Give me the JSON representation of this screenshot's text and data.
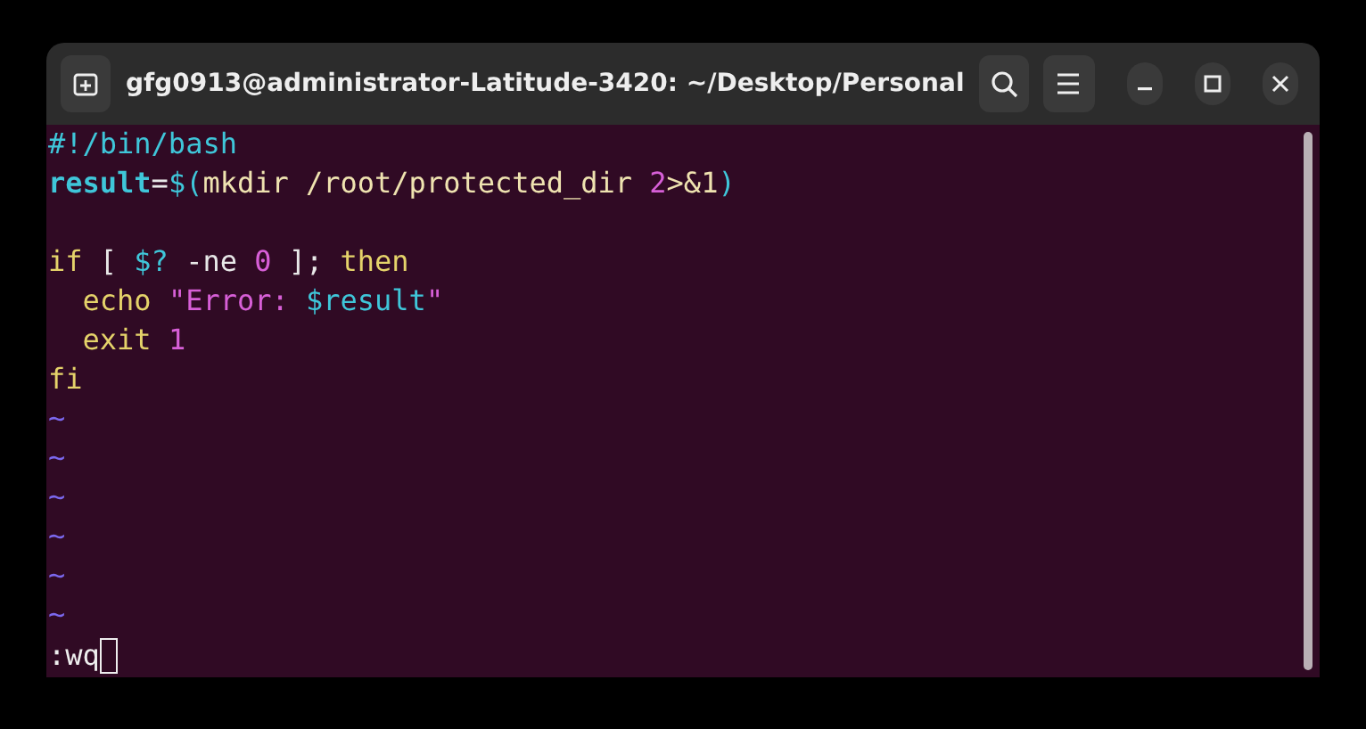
{
  "window": {
    "title": "gfg0913@administrator-Latitude-3420: ~/Desktop/Personal"
  },
  "editor": {
    "lines": [
      {
        "kind": "code",
        "segments": [
          {
            "text": "#!/bin/bash",
            "color": "#3fc6d9"
          }
        ]
      },
      {
        "kind": "code",
        "segments": [
          {
            "text": "result",
            "color": "#3fc6d9",
            "bold": true
          },
          {
            "text": "=",
            "color": "#e8e8e8"
          },
          {
            "text": "$(",
            "color": "#3fc6d9"
          },
          {
            "text": "mkdir /root/protected_dir ",
            "color": "#efe3b0"
          },
          {
            "text": "2",
            "color": "#d75fd7"
          },
          {
            "text": ">&1",
            "color": "#efe3b0"
          },
          {
            "text": ")",
            "color": "#3fc6d9"
          }
        ]
      },
      {
        "kind": "blank"
      },
      {
        "kind": "code",
        "segments": [
          {
            "text": "if",
            "color": "#e5d36a"
          },
          {
            "text": " [ ",
            "color": "#e8e8e8"
          },
          {
            "text": "$?",
            "color": "#3fc6d9"
          },
          {
            "text": " -ne ",
            "color": "#e8e8e8"
          },
          {
            "text": "0",
            "color": "#d75fd7"
          },
          {
            "text": " ]; ",
            "color": "#e8e8e8"
          },
          {
            "text": "then",
            "color": "#e5d36a"
          }
        ]
      },
      {
        "kind": "code",
        "segments": [
          {
            "text": "  echo ",
            "color": "#e5d36a"
          },
          {
            "text": "\"Error: ",
            "color": "#d75fd7"
          },
          {
            "text": "$result",
            "color": "#3fc6d9"
          },
          {
            "text": "\"",
            "color": "#d75fd7"
          }
        ]
      },
      {
        "kind": "code",
        "segments": [
          {
            "text": "  exit ",
            "color": "#e5d36a"
          },
          {
            "text": "1",
            "color": "#d75fd7"
          }
        ]
      },
      {
        "kind": "code",
        "segments": [
          {
            "text": "fi",
            "color": "#e5d36a"
          }
        ]
      },
      {
        "kind": "tilde",
        "text": "~"
      },
      {
        "kind": "tilde",
        "text": "~"
      },
      {
        "kind": "tilde",
        "text": "~"
      },
      {
        "kind": "tilde",
        "text": "~"
      },
      {
        "kind": "tilde",
        "text": "~"
      },
      {
        "kind": "tilde",
        "text": "~"
      }
    ],
    "command_line": ":wq"
  }
}
